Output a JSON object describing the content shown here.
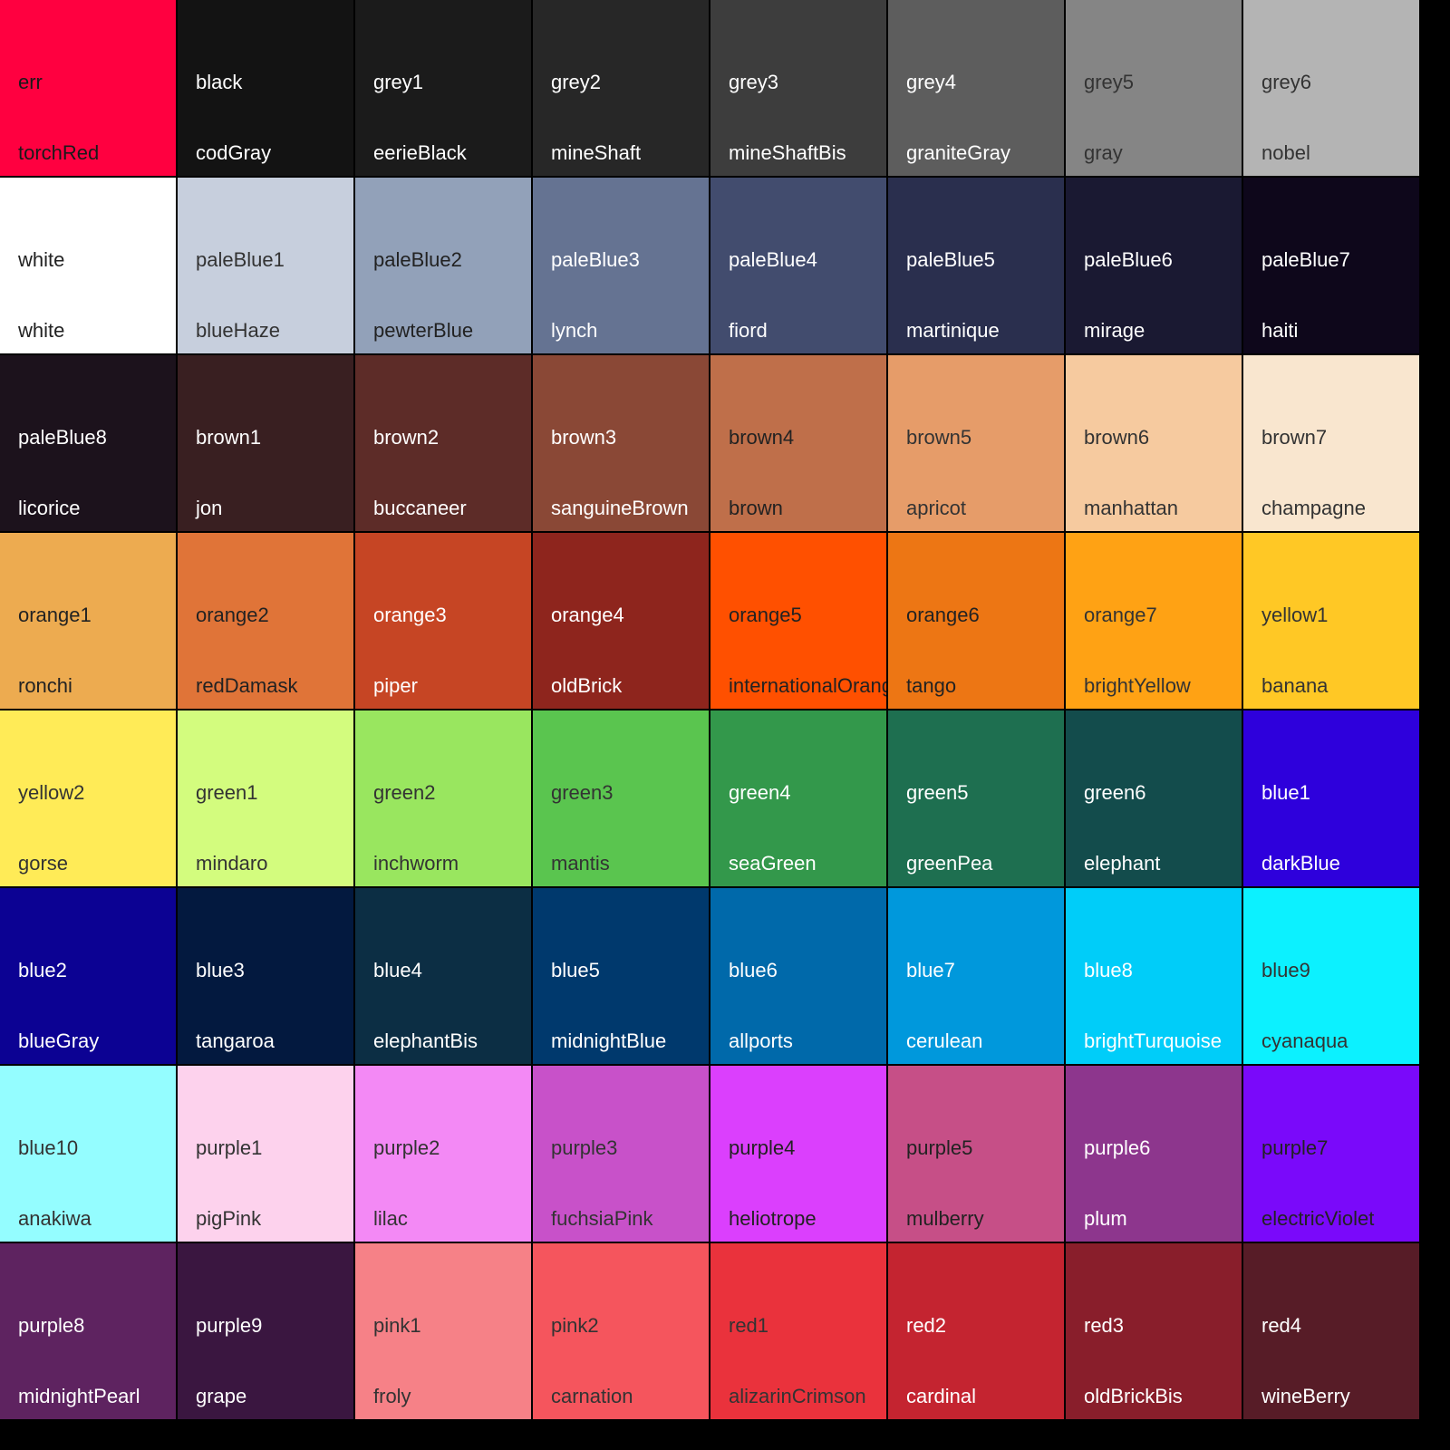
{
  "palette": [
    {
      "alias": "err",
      "name": "torchRed",
      "color": "#ff0040",
      "text": "#1a1a1a"
    },
    {
      "alias": "black",
      "name": "codGray",
      "color": "#131313",
      "text": "#ffffff"
    },
    {
      "alias": "grey1",
      "name": "eerieBlack",
      "color": "#1b1b1b",
      "text": "#ffffff"
    },
    {
      "alias": "grey2",
      "name": "mineShaft",
      "color": "#272727",
      "text": "#ffffff"
    },
    {
      "alias": "grey3",
      "name": "mineShaftBis",
      "color": "#3d3d3d",
      "text": "#ffffff"
    },
    {
      "alias": "grey4",
      "name": "graniteGray",
      "color": "#5d5d5d",
      "text": "#ffffff"
    },
    {
      "alias": "grey5",
      "name": "gray",
      "color": "#858585",
      "text": "#333333"
    },
    {
      "alias": "grey6",
      "name": "nobel",
      "color": "#b4b4b4",
      "text": "#333333"
    },
    {
      "alias": "white",
      "name": "white",
      "color": "#ffffff",
      "text": "#222222"
    },
    {
      "alias": "paleBlue1",
      "name": "blueHaze",
      "color": "#c7cfdd",
      "text": "#333333"
    },
    {
      "alias": "paleBlue2",
      "name": "pewterBlue",
      "color": "#92a1b9",
      "text": "#222222"
    },
    {
      "alias": "paleBlue3",
      "name": "lynch",
      "color": "#657392",
      "text": "#ffffff"
    },
    {
      "alias": "paleBlue4",
      "name": "fiord",
      "color": "#424c6e",
      "text": "#ffffff"
    },
    {
      "alias": "paleBlue5",
      "name": "martinique",
      "color": "#2a2f4e",
      "text": "#ffffff"
    },
    {
      "alias": "paleBlue6",
      "name": "mirage",
      "color": "#1a1932",
      "text": "#ffffff"
    },
    {
      "alias": "paleBlue7",
      "name": "haiti",
      "color": "#0e071b",
      "text": "#ffffff"
    },
    {
      "alias": "paleBlue8",
      "name": "licorice",
      "color": "#1c121c",
      "text": "#ffffff"
    },
    {
      "alias": "brown1",
      "name": "jon",
      "color": "#391f21",
      "text": "#ffffff"
    },
    {
      "alias": "brown2",
      "name": "buccaneer",
      "color": "#5d2c28",
      "text": "#ffffff"
    },
    {
      "alias": "brown3",
      "name": "sanguineBrown",
      "color": "#8a4836",
      "text": "#ffffff"
    },
    {
      "alias": "brown4",
      "name": "brown",
      "color": "#bf6f4a",
      "text": "#222222"
    },
    {
      "alias": "brown5",
      "name": "apricot",
      "color": "#e69c69",
      "text": "#333333"
    },
    {
      "alias": "brown6",
      "name": "manhattan",
      "color": "#f6ca9f",
      "text": "#333333"
    },
    {
      "alias": "brown7",
      "name": "champagne",
      "color": "#f9e6cf",
      "text": "#333333"
    },
    {
      "alias": "orange1",
      "name": "ronchi",
      "color": "#edab50",
      "text": "#222222"
    },
    {
      "alias": "orange2",
      "name": "redDamask",
      "color": "#e07438",
      "text": "#222222"
    },
    {
      "alias": "orange3",
      "name": "piper",
      "color": "#c64524",
      "text": "#ffffff"
    },
    {
      "alias": "orange4",
      "name": "oldBrick",
      "color": "#8e251d",
      "text": "#ffffff"
    },
    {
      "alias": "orange5",
      "name": "internationalOrange",
      "color": "#ff5000",
      "text": "#222222"
    },
    {
      "alias": "orange6",
      "name": "tango",
      "color": "#ed7614",
      "text": "#222222"
    },
    {
      "alias": "orange7",
      "name": "brightYellow",
      "color": "#ffa214",
      "text": "#333333"
    },
    {
      "alias": "yellow1",
      "name": "banana",
      "color": "#ffc825",
      "text": "#333333"
    },
    {
      "alias": "yellow2",
      "name": "gorse",
      "color": "#ffeb57",
      "text": "#333333"
    },
    {
      "alias": "green1",
      "name": "mindaro",
      "color": "#d3fc7e",
      "text": "#333333"
    },
    {
      "alias": "green2",
      "name": "inchworm",
      "color": "#99e65f",
      "text": "#333333"
    },
    {
      "alias": "green3",
      "name": "mantis",
      "color": "#5ac54f",
      "text": "#333333"
    },
    {
      "alias": "green4",
      "name": "seaGreen",
      "color": "#33984b",
      "text": "#ffffff"
    },
    {
      "alias": "green5",
      "name": "greenPea",
      "color": "#1e6f50",
      "text": "#ffffff"
    },
    {
      "alias": "green6",
      "name": "elephant",
      "color": "#134c4c",
      "text": "#ffffff"
    },
    {
      "alias": "blue1",
      "name": "darkBlue",
      "color": "#2e00dc",
      "text": "#ffffff"
    },
    {
      "alias": "blue2",
      "name": "blueGray",
      "color": "#0c0293",
      "text": "#ffffff"
    },
    {
      "alias": "blue3",
      "name": "tangaroa",
      "color": "#03193f",
      "text": "#ffffff"
    },
    {
      "alias": "blue4",
      "name": "elephantBis",
      "color": "#0c2e44",
      "text": "#ffffff"
    },
    {
      "alias": "blue5",
      "name": "midnightBlue",
      "color": "#00396d",
      "text": "#ffffff"
    },
    {
      "alias": "blue6",
      "name": "allports",
      "color": "#0069aa",
      "text": "#ffffff"
    },
    {
      "alias": "blue7",
      "name": "cerulean",
      "color": "#0098dc",
      "text": "#ffffff"
    },
    {
      "alias": "blue8",
      "name": "brightTurquoise",
      "color": "#00cdf9",
      "text": "#ffffff"
    },
    {
      "alias": "blue9",
      "name": "cyanaqua",
      "color": "#0cf1ff",
      "text": "#333333"
    },
    {
      "alias": "blue10",
      "name": "anakiwa",
      "color": "#94fdff",
      "text": "#333333"
    },
    {
      "alias": "purple1",
      "name": "pigPink",
      "color": "#fdd2ed",
      "text": "#333333"
    },
    {
      "alias": "purple2",
      "name": "lilac",
      "color": "#f389f5",
      "text": "#333333"
    },
    {
      "alias": "purple3",
      "name": "fuchsiaPink",
      "color": "#c851c9",
      "text": "#333333"
    },
    {
      "alias": "purple4",
      "name": "heliotrope",
      "color": "#db3ffd",
      "text": "#222222"
    },
    {
      "alias": "purple5",
      "name": "mulberry",
      "color": "#c64f87",
      "text": "#222222"
    },
    {
      "alias": "purple6",
      "name": "plum",
      "color": "#8d368d",
      "text": "#ffffff"
    },
    {
      "alias": "purple7",
      "name": "electricViolet",
      "color": "#7a09fa",
      "text": "#222222"
    },
    {
      "alias": "purple8",
      "name": "midnightPearl",
      "color": "#5e2360",
      "text": "#ffffff"
    },
    {
      "alias": "purple9",
      "name": "grape",
      "color": "#3a1640",
      "text": "#ffffff"
    },
    {
      "alias": "pink1",
      "name": "froly",
      "color": "#f68187",
      "text": "#333333"
    },
    {
      "alias": "pink2",
      "name": "carnation",
      "color": "#f5555d",
      "text": "#333333"
    },
    {
      "alias": "red1",
      "name": "alizarinCrimson",
      "color": "#ea323c",
      "text": "#333333"
    },
    {
      "alias": "red2",
      "name": "cardinal",
      "color": "#c42430",
      "text": "#ffffff"
    },
    {
      "alias": "red3",
      "name": "oldBrickBis",
      "color": "#891e2b",
      "text": "#ffffff"
    },
    {
      "alias": "red4",
      "name": "wineBerry",
      "color": "#571c27",
      "text": "#ffffff"
    }
  ]
}
